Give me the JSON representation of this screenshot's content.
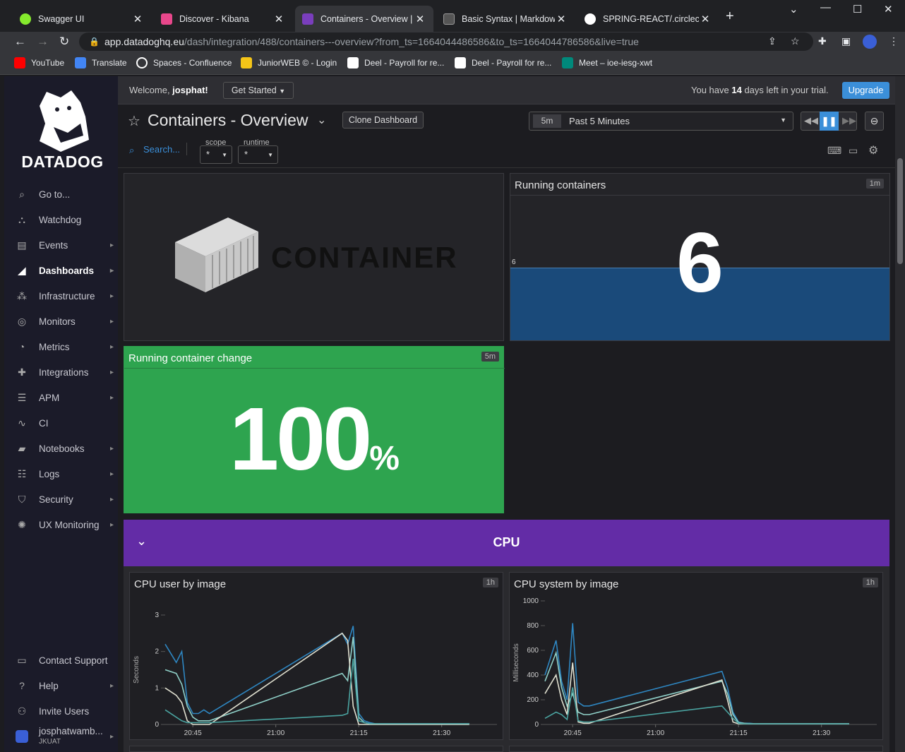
{
  "browser": {
    "tabs": [
      {
        "title": "Swagger UI",
        "color": "#85ea2d"
      },
      {
        "title": "Discover - Kibana",
        "color": "#e8478b"
      },
      {
        "title": "Containers - Overview | D",
        "color": "#7a3ebd"
      },
      {
        "title": "Basic Syntax | Markdown",
        "color": "#888888"
      },
      {
        "title": "SPRING-REACT/.circleci at",
        "color": "#ffffff"
      }
    ],
    "url_host": "app.datadoghq.eu",
    "url_path": "/dash/integration/488/containers---overview?from_ts=1664044486586&to_ts=1664044786586&live=true",
    "bookmarks": [
      {
        "label": "YouTube",
        "color": "#ff0000"
      },
      {
        "label": "Translate",
        "color": "#4285f4"
      },
      {
        "label": "Spaces - Confluence",
        "color": "#ffffff"
      },
      {
        "label": "JuniorWEB © - Login",
        "color": "#f5c518"
      },
      {
        "label": "Deel - Payroll for re...",
        "color": "#ffffff"
      },
      {
        "label": "Deel - Payroll for re...",
        "color": "#ffffff"
      },
      {
        "label": "Meet – ioe-iesg-xwt",
        "color": "#00897b"
      }
    ]
  },
  "sidebar": {
    "brand": "DATADOG",
    "items": [
      {
        "label": "Go to...",
        "icon": "search-icon",
        "chevron": false
      },
      {
        "label": "Watchdog",
        "icon": "binoculars-icon",
        "chevron": false
      },
      {
        "label": "Events",
        "icon": "events-icon",
        "chevron": true
      },
      {
        "label": "Dashboards",
        "icon": "dashboards-icon",
        "chevron": true
      },
      {
        "label": "Infrastructure",
        "icon": "infrastructure-icon",
        "chevron": true
      },
      {
        "label": "Monitors",
        "icon": "monitors-icon",
        "chevron": true
      },
      {
        "label": "Metrics",
        "icon": "metrics-icon",
        "chevron": true
      },
      {
        "label": "Integrations",
        "icon": "puzzle-icon",
        "chevron": true
      },
      {
        "label": "APM",
        "icon": "apm-icon",
        "chevron": true
      },
      {
        "label": "CI",
        "icon": "ci-icon",
        "chevron": false
      },
      {
        "label": "Notebooks",
        "icon": "notebook-icon",
        "chevron": true
      },
      {
        "label": "Logs",
        "icon": "logs-icon",
        "chevron": true
      },
      {
        "label": "Security",
        "icon": "shield-icon",
        "chevron": true
      },
      {
        "label": "UX Monitoring",
        "icon": "ux-icon",
        "chevron": true
      }
    ],
    "bottom": [
      {
        "label": "Contact Support",
        "icon": "chat-icon",
        "chevron": false
      },
      {
        "label": "Help",
        "icon": "help-icon",
        "chevron": true
      },
      {
        "label": "Invite Users",
        "icon": "users-icon",
        "chevron": false
      }
    ],
    "user_name": "josphatwamb...",
    "user_org": "JKUAT"
  },
  "header": {
    "welcome_prefix": "Welcome, ",
    "welcome_user": "josphat!",
    "get_started": "Get Started",
    "trial_prefix": "You have ",
    "trial_days": "14",
    "trial_suffix": " days left in your trial.",
    "upgrade": "Upgrade"
  },
  "dashboard": {
    "title": "Containers - Overview",
    "clone": "Clone Dashboard",
    "time_badge": "5m",
    "time_label": "Past 5 Minutes",
    "search": "Search...",
    "vars": [
      {
        "name": "scope",
        "value": "*"
      },
      {
        "name": "runtime",
        "value": "*"
      }
    ]
  },
  "widgets": {
    "image_text": "CONTAINER",
    "running": {
      "title": "Running containers",
      "badge": "1m",
      "value": "6",
      "axis": "6"
    },
    "change": {
      "title": "Running container change",
      "badge": "5m",
      "value": "100",
      "unit": "%"
    },
    "cpu_group": "CPU",
    "cpu_user": {
      "title": "CPU user by image",
      "badge": "1h"
    },
    "cpu_system": {
      "title": "CPU system by image",
      "badge": "1h"
    }
  },
  "colors": {
    "accent": "#632ca6",
    "green": "#2ea44f",
    "blue": "#1a4a7a",
    "link": "#3b8fd9"
  },
  "chart_data": [
    {
      "type": "line",
      "title": "CPU user by image",
      "ylabel": "Seconds",
      "ylim": [
        0,
        3
      ],
      "yticks": [
        0,
        1,
        2,
        3
      ],
      "xticks": [
        "20:45",
        "21:00",
        "21:15",
        "21:30"
      ],
      "x": [
        0,
        2,
        3,
        4,
        5,
        6,
        7,
        8,
        32,
        33,
        34,
        35,
        36,
        37,
        38,
        40,
        50,
        55
      ],
      "series": [
        {
          "color": "#2e86c1",
          "values": [
            2.2,
            1.7,
            2.0,
            0.6,
            0.3,
            0.3,
            0.4,
            0.3,
            2.5,
            2.2,
            2.7,
            0.3,
            0.1,
            0.05,
            0.02,
            0.02,
            0.02,
            0.02
          ]
        },
        {
          "color": "#8fd0c8",
          "values": [
            1.5,
            1.4,
            1.1,
            0.5,
            0.2,
            0.1,
            0.1,
            0.1,
            1.4,
            1.2,
            2.4,
            0.2,
            0.05,
            0.02,
            0.02,
            0.02,
            0.02,
            0.02
          ]
        },
        {
          "color": "#e0e0d0",
          "values": [
            1.0,
            0.8,
            0.6,
            0.1,
            0.0,
            0.0,
            0.0,
            0.0,
            2.5,
            2.3,
            0.5,
            0.0,
            0.0,
            0.0,
            0.0,
            0.0,
            0.0,
            0.0
          ]
        },
        {
          "color": "#4aa3a0",
          "values": [
            0.4,
            0.2,
            0.1,
            0.05,
            0.05,
            0.05,
            0.05,
            0.05,
            0.25,
            0.3,
            1.8,
            0.1,
            0.05,
            0.02,
            0.02,
            0.02,
            0.02,
            0.02
          ]
        }
      ]
    },
    {
      "type": "line",
      "title": "CPU system by image",
      "ylabel": "Milliseconds",
      "ylim": [
        0,
        1000
      ],
      "yticks": [
        0,
        200,
        400,
        600,
        800,
        1000
      ],
      "xticks": [
        "20:45",
        "21:00",
        "21:15",
        "21:30"
      ],
      "x": [
        0,
        2,
        3,
        4,
        5,
        6,
        7,
        8,
        32,
        33,
        34,
        35,
        36,
        37,
        38,
        40,
        50,
        55
      ],
      "series": [
        {
          "color": "#2e86c1",
          "values": [
            400,
            680,
            350,
            200,
            820,
            180,
            150,
            150,
            430,
            300,
            100,
            20,
            10,
            10,
            5,
            5,
            5,
            5
          ]
        },
        {
          "color": "#8fd0c8",
          "values": [
            350,
            580,
            300,
            150,
            250,
            100,
            80,
            80,
            350,
            250,
            80,
            15,
            10,
            5,
            5,
            5,
            5,
            5
          ]
        },
        {
          "color": "#e0e0d0",
          "values": [
            250,
            400,
            200,
            80,
            500,
            20,
            10,
            10,
            360,
            200,
            20,
            5,
            5,
            5,
            5,
            5,
            5,
            5
          ]
        },
        {
          "color": "#4aa3a0",
          "values": [
            50,
            100,
            80,
            40,
            300,
            30,
            20,
            20,
            150,
            100,
            50,
            10,
            5,
            5,
            5,
            5,
            5,
            5
          ]
        }
      ]
    }
  ]
}
